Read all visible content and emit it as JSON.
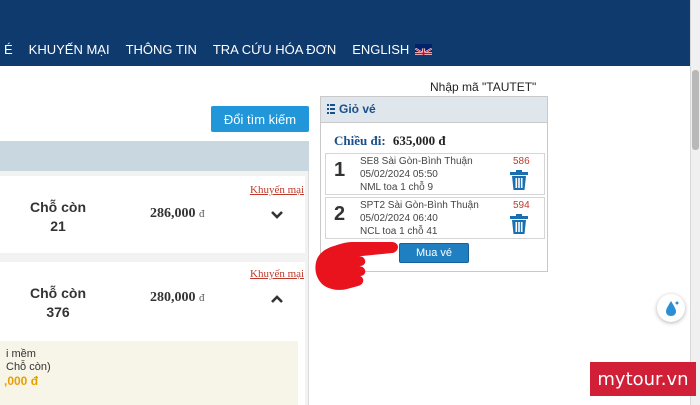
{
  "nav": {
    "items": [
      "É",
      "KHUYẾN MẠI",
      "THÔNG TIN",
      "TRA CỨU HÓA ĐƠN",
      "ENGLISH"
    ]
  },
  "promo_code_text": "Nhập mã \"TAUTET\"",
  "change_search_label": "Đổi tìm kiếm",
  "results": [
    {
      "seat_label": "Chỗ còn",
      "seat_count": "21",
      "price": "286,000",
      "currency": "đ",
      "promo_link": "Khuyến mại"
    },
    {
      "seat_label": "Chỗ còn",
      "seat_count": "376",
      "price": "280,000",
      "currency": "đ",
      "promo_link": "Khuyến mại"
    }
  ],
  "sub_option": {
    "line1": "i mềm",
    "line2": "Chỗ còn)",
    "price": ",000 đ"
  },
  "cart": {
    "title": "Giỏ vé",
    "direction_label": "Chiều đi:",
    "direction_amount": "635,000 đ",
    "tickets": [
      {
        "index": "1",
        "route": "SE8 Sài Gòn-Bình Thuận",
        "datetime": "05/02/2024 05:50",
        "seat": "NML toa 1 chỗ 9",
        "code": "586"
      },
      {
        "index": "2",
        "route": "SPT2 Sài Gòn-Bình Thuận",
        "datetime": "05/02/2024 06:40",
        "seat": "NCL toa 1 chỗ 41",
        "code": "594"
      }
    ],
    "buy_label": "Mua vé"
  },
  "watermark": "mytour.vn",
  "colors": {
    "nav_bg": "#0e3a6e",
    "accent_button": "#2196d9",
    "buy_button": "#1f7fc1",
    "hand": "#e8131c",
    "brand": "#d01f36"
  },
  "icons": [
    "uk-flag-icon",
    "list-icon",
    "trash-icon",
    "pointing-hand-icon",
    "water-drop-icon",
    "chevron-down-icon",
    "chevron-up-icon"
  ]
}
